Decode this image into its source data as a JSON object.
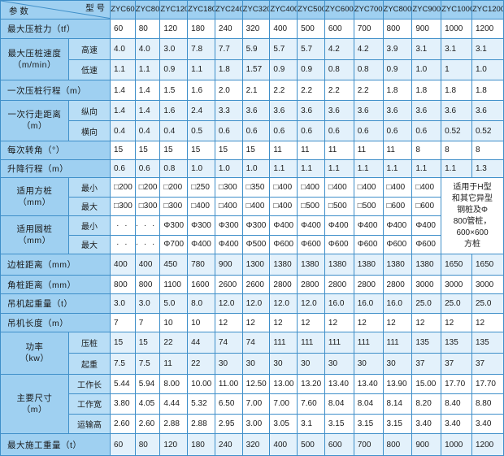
{
  "header": {
    "param_label": "参 数",
    "model_label": "型 号",
    "models": [
      "ZYC60",
      "ZYC80",
      "ZYC120",
      "ZYC180",
      "ZYC240",
      "ZYC320",
      "ZYC400",
      "ZYC500",
      "ZYC600",
      "ZYC700",
      "ZYC800",
      "ZYC900",
      "ZYC1000",
      "ZYC1200"
    ]
  },
  "rows": {
    "max_pressure": {
      "label": "最大压桩力（tf）",
      "values": [
        "60",
        "80",
        "120",
        "180",
        "240",
        "320",
        "400",
        "500",
        "600",
        "700",
        "800",
        "900",
        "1000",
        "1200"
      ]
    },
    "speed": {
      "label": "最大压桩速度\n（m/min）",
      "high": {
        "label": "高速",
        "values": [
          "4.0",
          "4.0",
          "3.0",
          "7.8",
          "7.7",
          "5.9",
          "5.7",
          "5.7",
          "4.2",
          "4.2",
          "3.9",
          "3.1",
          "3.1",
          "3.1"
        ]
      },
      "low": {
        "label": "低速",
        "values": [
          "1.1",
          "1.1",
          "0.9",
          "1.1",
          "1.8",
          "1.57",
          "0.9",
          "0.9",
          "0.8",
          "0.8",
          "0.9",
          "1.0",
          "1",
          "1.0"
        ]
      }
    },
    "stroke": {
      "label": "一次压桩行程（m）",
      "values": [
        "1.4",
        "1.4",
        "1.5",
        "1.6",
        "2.0",
        "2.1",
        "2.2",
        "2.2",
        "2.2",
        "2.2",
        "1.8",
        "1.8",
        "1.8",
        "1.8"
      ]
    },
    "walk": {
      "label": "一次行走距离\n（m）",
      "long": {
        "label": "纵向",
        "values": [
          "1.4",
          "1.4",
          "1.6",
          "2.4",
          "3.3",
          "3.6",
          "3.6",
          "3.6",
          "3.6",
          "3.6",
          "3.6",
          "3.6",
          "3.6",
          "3.6"
        ]
      },
      "trans": {
        "label": "横向",
        "values": [
          "0.4",
          "0.4",
          "0.4",
          "0.5",
          "0.6",
          "0.6",
          "0.6",
          "0.6",
          "0.6",
          "0.6",
          "0.6",
          "0.6",
          "0.52",
          "0.52"
        ]
      }
    },
    "rotation": {
      "label": "每次转角（°）",
      "values": [
        "15",
        "15",
        "15",
        "15",
        "15",
        "15",
        "11",
        "11",
        "11",
        "11",
        "11",
        "8",
        "8",
        "8"
      ]
    },
    "lift": {
      "label": "升降行程（m）",
      "values": [
        "0.6",
        "0.6",
        "0.8",
        "1.0",
        "1.0",
        "1.0",
        "1.1",
        "1.1",
        "1.1",
        "1.1",
        "1.1",
        "1.1",
        "1.1",
        "1.3"
      ]
    },
    "square": {
      "label": "适用方桩\n（mm）",
      "min": {
        "label": "最小",
        "values": [
          "□200",
          "□200",
          "□200",
          "□250",
          "□300",
          "□350",
          "□400",
          "□400",
          "□400",
          "□400",
          "□400",
          "□400"
        ]
      },
      "max": {
        "label": "最大",
        "values": [
          "□300",
          "□300",
          "□300",
          "□400",
          "□400",
          "□400",
          "□400",
          "□500",
          "□500",
          "□500",
          "□600",
          "□600"
        ]
      }
    },
    "round": {
      "label": "适用圆桩\n（mm）",
      "min": {
        "label": "最小",
        "values": [
          "·  ·",
          "·  ·  ·  ·",
          "Φ300",
          "Φ300",
          "Φ300",
          "Φ300",
          "Φ400",
          "Φ400",
          "Φ400",
          "Φ400",
          "Φ400",
          "Φ400"
        ]
      },
      "max": {
        "label": "最大",
        "values": [
          "·  ·",
          "·  ·  ·  ·",
          "Φ700",
          "Φ400",
          "Φ400",
          "Φ500",
          "Φ600",
          "Φ600",
          "Φ600",
          "Φ600",
          "Φ600",
          "Φ600"
        ]
      }
    },
    "note": "适用于H型\n和其它异型\n钢桩及Φ\n800管桩，\n600×600\n方桩",
    "side_dist": {
      "label": "边桩距离（mm）",
      "values": [
        "400",
        "400",
        "450",
        "780",
        "900",
        "1300",
        "1380",
        "1380",
        "1380",
        "1380",
        "1380",
        "1380",
        "1650",
        "1650"
      ]
    },
    "corner_dist": {
      "label": "角桩距离（mm）",
      "values": [
        "800",
        "800",
        "1100",
        "1600",
        "2600",
        "2600",
        "2800",
        "2800",
        "2800",
        "2800",
        "2800",
        "3000",
        "3000",
        "3000"
      ]
    },
    "crane_load": {
      "label": "吊机起重量（t）",
      "values": [
        "3.0",
        "3.0",
        "5.0",
        "8.0",
        "12.0",
        "12.0",
        "12.0",
        "12.0",
        "16.0",
        "16.0",
        "16.0",
        "25.0",
        "25.0",
        "25.0"
      ]
    },
    "crane_len": {
      "label": "吊机长度（m）",
      "values": [
        "7",
        "7",
        "10",
        "10",
        "12",
        "12",
        "12",
        "12",
        "12",
        "12",
        "12",
        "12",
        "12",
        "12"
      ]
    },
    "power": {
      "label": "功率\n（kw）",
      "press": {
        "label": "压桩",
        "values": [
          "15",
          "15",
          "22",
          "44",
          "74",
          "74",
          "111",
          "111",
          "111",
          "111",
          "111",
          "135",
          "135",
          "135"
        ]
      },
      "lift": {
        "label": "起重",
        "values": [
          "7.5",
          "7.5",
          "11",
          "22",
          "30",
          "30",
          "30",
          "30",
          "30",
          "30",
          "30",
          "37",
          "37",
          "37"
        ]
      }
    },
    "size": {
      "label": "主要尺寸\n（m）",
      "work_len": {
        "label": "工作长",
        "values": [
          "5.44",
          "5.94",
          "8.00",
          "10.00",
          "11.00",
          "12.50",
          "13.00",
          "13.20",
          "13.40",
          "13.40",
          "13.90",
          "15.00",
          "17.70",
          "17.70"
        ]
      },
      "work_wid": {
        "label": "工作宽",
        "values": [
          "3.80",
          "4.05",
          "4.44",
          "5.32",
          "6.50",
          "7.00",
          "7.00",
          "7.60",
          "8.04",
          "8.04",
          "8.14",
          "8.20",
          "8.40",
          "8.80"
        ]
      },
      "trans_h": {
        "label": "运输高",
        "values": [
          "2.60",
          "2.60",
          "2.88",
          "2.88",
          "2.95",
          "3.00",
          "3.05",
          "3.1",
          "3.15",
          "3.15",
          "3.15",
          "3.40",
          "3.40",
          "3.40"
        ]
      }
    },
    "max_weight": {
      "label": "最大施工重量（t）",
      "values": [
        "60",
        "80",
        "120",
        "180",
        "240",
        "320",
        "400",
        "500",
        "600",
        "700",
        "800",
        "900",
        "1000",
        "1200"
      ]
    }
  }
}
